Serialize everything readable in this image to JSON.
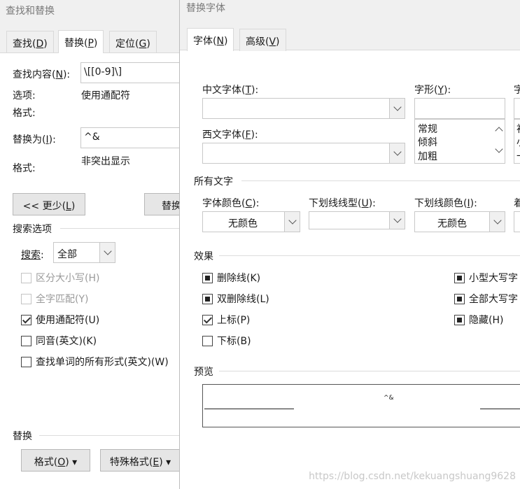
{
  "find_dialog": {
    "title": "查找和替换",
    "tabs": [
      {
        "label": "查找(",
        "key": "D",
        "close": ")"
      },
      {
        "label": "替换(",
        "key": "P",
        "close": ")"
      },
      {
        "label": "定位(",
        "key": "G",
        "close": ")"
      }
    ],
    "find_label_pre": "查找内容(",
    "find_label_key": "N",
    "find_label_post": "):",
    "find_value": "\\[[0-9]\\]",
    "options_label": "选项:",
    "options_value": "使用通配符",
    "format_label": "格式:",
    "replace_label_pre": "替换为(",
    "replace_label_key": "I",
    "replace_label_post": "):",
    "replace_value": "^&",
    "format2_label": "格式:",
    "format2_value": "非突出显示",
    "less_button_pre": "<< 更少(",
    "less_button_key": "L",
    "less_button_post": ")",
    "replace_button": "替换",
    "search_options_heading": "搜索选项",
    "search_label_pre": "搜索",
    "search_label_post": ":",
    "search_value": "全部",
    "checkboxes": [
      {
        "label": "区分大小写(H)",
        "checked": false,
        "disabled": true
      },
      {
        "label": "全字匹配(Y)",
        "checked": false,
        "disabled": true
      },
      {
        "label": "使用通配符(U)",
        "checked": true,
        "disabled": false
      },
      {
        "label": "同音(英文)(K)",
        "checked": false,
        "disabled": false
      },
      {
        "label": "查找单词的所有形式(英文)(W)",
        "checked": false,
        "disabled": false
      }
    ],
    "replace_heading": "替换",
    "format_button_pre": "格式(",
    "format_button_key": "O",
    "format_button_post": ") ▾",
    "special_button_pre": "特殊格式(",
    "special_button_key": "E",
    "special_button_post": ") ▾"
  },
  "font_dialog": {
    "title": "替换字体",
    "tabs": [
      {
        "label": "字体(",
        "key": "N",
        "close": ")"
      },
      {
        "label": "高级(",
        "key": "V",
        "close": ")"
      }
    ],
    "cn_font_label_pre": "中文字体(",
    "cn_font_label_key": "T",
    "cn_font_label_post": "):",
    "cn_font_value": "",
    "style_label_pre": "字形(",
    "style_label_key": "Y",
    "style_label_post": "):",
    "style_value": "",
    "style_options": [
      "常规",
      "倾斜",
      "加粗"
    ],
    "size_label_cut": "字",
    "size_options_cut": [
      "初",
      "小",
      "一"
    ],
    "west_font_label_pre": "西文字体(",
    "west_font_label_key": "F",
    "west_font_label_post": "):",
    "west_font_value": "",
    "all_text_heading": "所有文字",
    "font_color_label_pre": "字体颜色(",
    "font_color_label_key": "C",
    "font_color_label_post": "):",
    "font_color_value": "无颜色",
    "underline_type_label_pre": "下划线线型(",
    "underline_type_label_key": "U",
    "underline_type_label_post": "):",
    "underline_type_value": "",
    "underline_color_label_pre": "下划线颜色(",
    "underline_color_label_key": "I",
    "underline_color_label_post": "):",
    "underline_color_value": "无颜色",
    "emphasis_label_cut": "着",
    "effects_heading": "效果",
    "effects_left": [
      {
        "label": "删除线(K)",
        "state": "filled"
      },
      {
        "label": "双删除线(L)",
        "state": "filled"
      },
      {
        "label": "上标(P)",
        "state": "checked"
      },
      {
        "label": "下标(B)",
        "state": "empty"
      }
    ],
    "effects_right": [
      {
        "label": "小型大写字",
        "state": "filled"
      },
      {
        "label": "全部大写字",
        "state": "filled"
      },
      {
        "label": "隐藏(H)",
        "state": "filled"
      }
    ],
    "preview_heading": "预览",
    "preview_text": "^&"
  },
  "watermark": "https://blog.csdn.net/kekuangshuang9628"
}
